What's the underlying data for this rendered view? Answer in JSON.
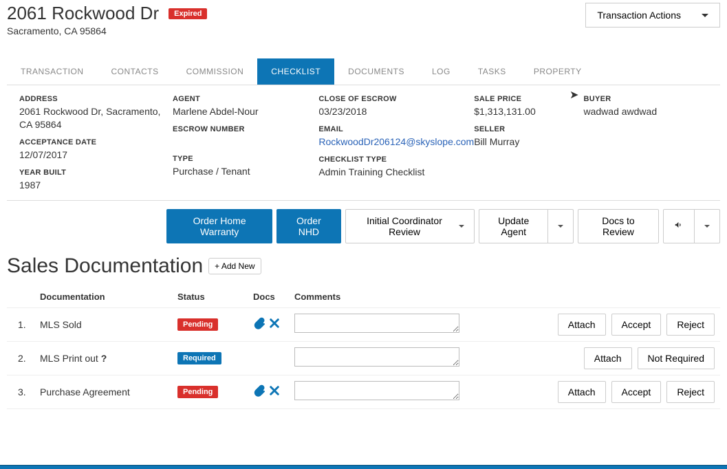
{
  "header": {
    "title": "2061 Rockwood Dr",
    "subtitle": "Sacramento, CA 95864",
    "status_badge": "Expired",
    "actions_button": "Transaction Actions"
  },
  "tabs": [
    {
      "label": "TRANSACTION"
    },
    {
      "label": "CONTACTS"
    },
    {
      "label": "COMMISSION"
    },
    {
      "label": "CHECKLIST",
      "active": true
    },
    {
      "label": "DOCUMENTS"
    },
    {
      "label": "LOG"
    },
    {
      "label": "TASKS"
    },
    {
      "label": "PROPERTY"
    }
  ],
  "details": {
    "address_label": "ADDRESS",
    "address_value": "2061 Rockwood Dr, Sacramento, CA 95864",
    "acceptance_label": "ACCEPTANCE DATE",
    "acceptance_value": "12/07/2017",
    "year_built_label": "YEAR BUILT",
    "year_built_value": "1987",
    "agent_label": "AGENT",
    "agent_value": "Marlene Abdel-Nour",
    "escrow_number_label": "ESCROW NUMBER",
    "escrow_number_value": "",
    "type_label": "TYPE",
    "type_value": "Purchase / Tenant",
    "close_label": "CLOSE OF ESCROW",
    "close_value": "03/23/2018",
    "email_label": "EMAIL",
    "email_value": "RockwoodDr206124@skyslope.com",
    "checklist_type_label": "CHECKLIST TYPE",
    "checklist_type_value": "Admin Training Checklist",
    "sale_price_label": "SALE PRICE",
    "sale_price_value": "$1,313,131.00",
    "seller_label": "SELLER",
    "seller_value": "Bill Murray",
    "buyer_label": "BUYER",
    "buyer_value": "wadwad awdwad"
  },
  "action_row": {
    "order_home_warranty": "Order Home Warranty",
    "order_nhd": "Order NHD",
    "stage_select": "Initial Coordinator Review",
    "update_agent": "Update Agent",
    "docs_to_review": "Docs to Review"
  },
  "section": {
    "title": "Sales Documentation",
    "add_new": "Add New"
  },
  "table": {
    "headers": {
      "num": "",
      "documentation": "Documentation",
      "status": "Status",
      "docs": "Docs",
      "comments": "Comments",
      "actions": ""
    },
    "rows": [
      {
        "num": "1.",
        "name": "MLS Sold",
        "status": "Pending",
        "status_class": "pending",
        "has_docs": true,
        "comments": "",
        "actions": [
          "Attach",
          "Accept",
          "Reject"
        ]
      },
      {
        "num": "2.",
        "name": "MLS Print out",
        "help": true,
        "status": "Required",
        "status_class": "required",
        "has_docs": false,
        "comments": "",
        "actions": [
          "Attach",
          "Not Required"
        ]
      },
      {
        "num": "3.",
        "name": "Purchase Agreement",
        "status": "Pending",
        "status_class": "pending",
        "has_docs": true,
        "comments": "",
        "actions": [
          "Attach",
          "Accept",
          "Reject"
        ]
      }
    ]
  }
}
